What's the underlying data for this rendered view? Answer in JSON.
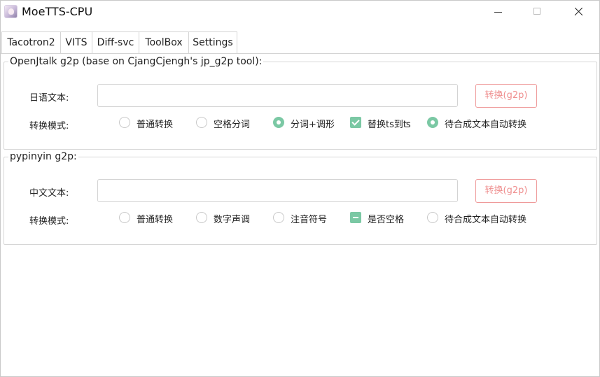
{
  "window": {
    "title": "MoeTTS-CPU",
    "icon": "moetts-app-icon"
  },
  "tabs": [
    {
      "label": "Tacotron2",
      "selected": false
    },
    {
      "label": "VITS",
      "selected": false
    },
    {
      "label": "Diff-svc",
      "selected": false
    },
    {
      "label": "ToolBox",
      "selected": true
    },
    {
      "label": "Settings",
      "selected": false
    }
  ],
  "openjtalk": {
    "group_title": "OpenJtalk g2p (base on CjangCjengh's jp_g2p tool):",
    "text_label": "日语文本:",
    "text_value": "",
    "convert_button": "转换(g2p)",
    "mode_label": "转换模式:",
    "options": [
      {
        "label": "普通转换",
        "type": "radio",
        "checked": false
      },
      {
        "label": "空格分词",
        "type": "radio",
        "checked": false
      },
      {
        "label": "分词+调形",
        "type": "radio",
        "checked": true
      },
      {
        "label": "替换ts到ʦ",
        "type": "checkbox",
        "checked": true
      },
      {
        "label": "待合成文本自动转换",
        "type": "radio",
        "checked": true
      }
    ]
  },
  "pypinyin": {
    "group_title": "pypinyin g2p:",
    "text_label": "中文文本:",
    "text_value": "",
    "convert_button": "转换(g2p)",
    "mode_label": "转换模式:",
    "options": [
      {
        "label": "普通转换",
        "type": "radio",
        "checked": false
      },
      {
        "label": "数字声调",
        "type": "radio",
        "checked": false
      },
      {
        "label": "注音符号",
        "type": "radio",
        "checked": false
      },
      {
        "label": "是否空格",
        "type": "checkbox",
        "checked": "partial"
      },
      {
        "label": "待合成文本自动转换",
        "type": "radio",
        "checked": false
      }
    ]
  },
  "colors": {
    "accent_green": "#7bc8a4",
    "button_red": "#ef8f8f",
    "border_gray": "#d4d4d4"
  }
}
